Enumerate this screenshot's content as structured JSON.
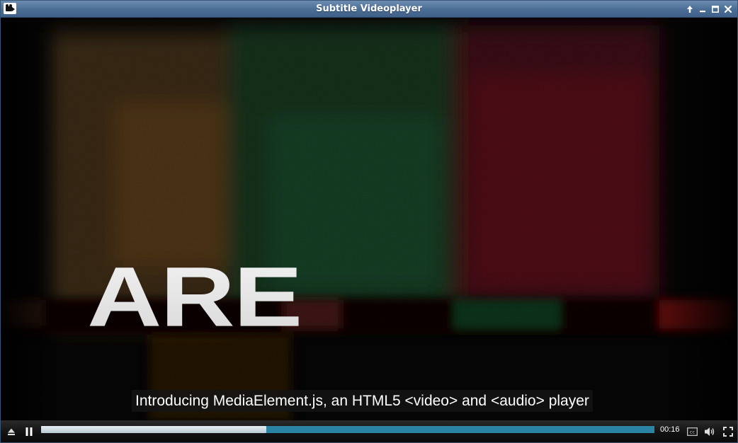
{
  "window": {
    "title": "Subtitle Videoplayer",
    "icon": "video-camera-icon",
    "buttons": [
      "up-arrow-icon",
      "minimize-icon",
      "maximize-icon",
      "close-icon"
    ]
  },
  "video": {
    "frame_text": "ARE",
    "subtitle": "Introducing MediaElement.js, an HTML5 <video> and <audio> player"
  },
  "controls": {
    "icons": [
      "eject-icon",
      "pause-icon",
      "closed-captions-icon",
      "volume-icon",
      "fullscreen-icon"
    ],
    "current_time": "00:16",
    "progress": 0.367,
    "accent_color": "#3b8eab"
  }
}
